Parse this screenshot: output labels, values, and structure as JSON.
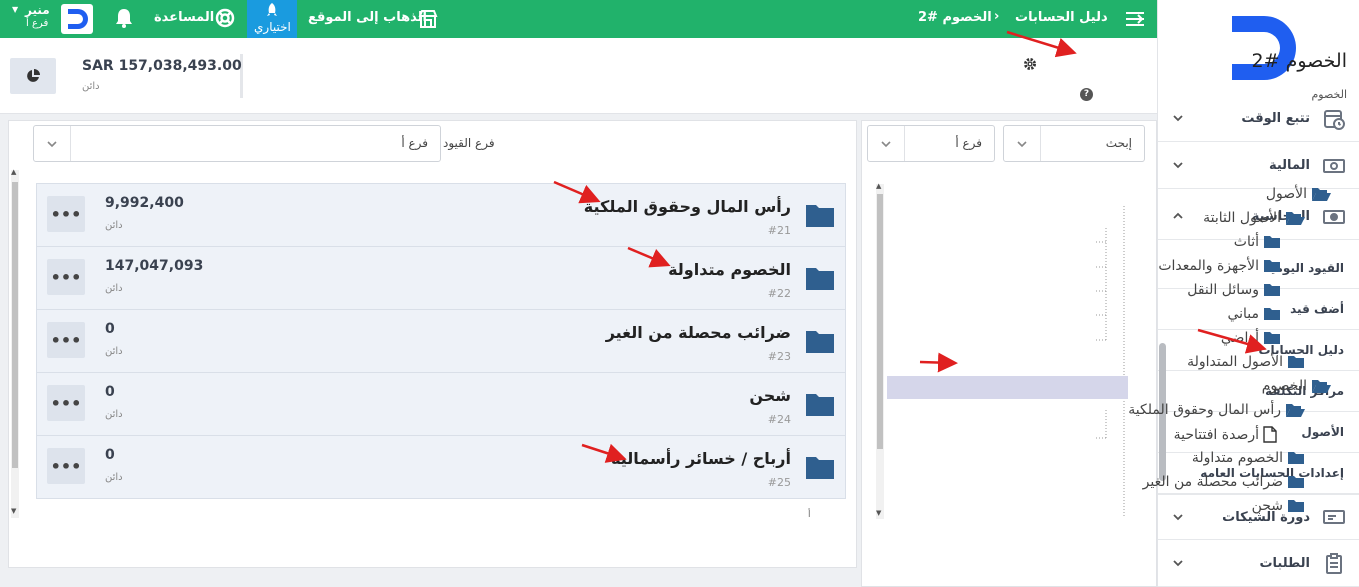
{
  "topbar": {
    "breadcrumb_root": "دليل الحسابات",
    "breadcrumb_separator": "›",
    "breadcrumb_current": "الخصوم #2",
    "visit_site_label": "الذهاب إلى الموقع",
    "trial_label": "اختياري",
    "help_label": "المساعدة",
    "user_name": "منير",
    "user_branch": "فرع أ"
  },
  "header": {
    "title": "الخصوم #2",
    "subtitle": "الخصوم",
    "kpi_value": "SAR 157,038,493.00",
    "kpi_label": "دائن"
  },
  "sidebar": {
    "sections": [
      {
        "label": "تتبع الوقت",
        "icon": "clock-calendar-icon"
      },
      {
        "label": "المالية",
        "icon": "money-icon"
      },
      {
        "label": "المحاسبة",
        "icon": "cash-icon"
      }
    ],
    "accounting_items": [
      "القيود اليومية",
      "أضف قيد",
      "دليل الحسابات",
      "مراكز التكلفة",
      "الأصول",
      "إعدادات الحسابات العامه"
    ],
    "bottom_sections": [
      {
        "label": "دورة الشيكات",
        "icon": "cheque-icon"
      },
      {
        "label": "الطلبات",
        "icon": "clipboard-icon"
      }
    ]
  },
  "tree_panel": {
    "search_placeholder": "إبحث",
    "branch_value": "فرع أ",
    "items": [
      {
        "label": "الأصول",
        "type": "folder-open"
      },
      {
        "label": "الأصول الثابتة",
        "type": "folder-open"
      },
      {
        "label": "أثاث",
        "type": "folder"
      },
      {
        "label": "الأجهزة والمعدات",
        "type": "folder"
      },
      {
        "label": "وسائل النقل",
        "type": "folder"
      },
      {
        "label": "مباني",
        "type": "folder"
      },
      {
        "label": "أراضي",
        "type": "folder"
      },
      {
        "label": "الأصول المتداولة",
        "type": "folder"
      },
      {
        "label": "الخصوم",
        "type": "folder-open"
      },
      {
        "label": "رأس المال وحقوق الملكية",
        "type": "folder-open"
      },
      {
        "label": "أرصدة افتتاحية",
        "type": "file"
      },
      {
        "label": "الخصوم متداولة",
        "type": "folder"
      },
      {
        "label": "ضرائب محصلة من الغير",
        "type": "folder"
      },
      {
        "label": "شحن",
        "type": "folder"
      }
    ]
  },
  "accounts_panel": {
    "filter_label": "فرع القيود",
    "filter_value": "فرع أ",
    "more_label": "•••",
    "stray_char": "أ",
    "accounts": [
      {
        "title": "رأس المال وحقوق الملكية",
        "number": "#21",
        "amount": "9,992,400",
        "amount_label": "دائن"
      },
      {
        "title": "الخصوم متداولة",
        "number": "#22",
        "amount": "147,047,093",
        "amount_label": "دائن"
      },
      {
        "title": "ضرائب محصلة من الغير",
        "number": "#23",
        "amount": "0",
        "amount_label": "دائن"
      },
      {
        "title": "شحن",
        "number": "#24",
        "amount": "0",
        "amount_label": "دائن"
      },
      {
        "title": "أرباح / خسائر رأسمالية",
        "number": "#25",
        "amount": "0",
        "amount_label": "دائن"
      }
    ]
  },
  "colors": {
    "topbar": "#21b26b",
    "trial": "#1a9bdf",
    "folder": "#2f5f8f",
    "logo": "#1f5ef0",
    "annotation_arrow": "#e02020"
  }
}
